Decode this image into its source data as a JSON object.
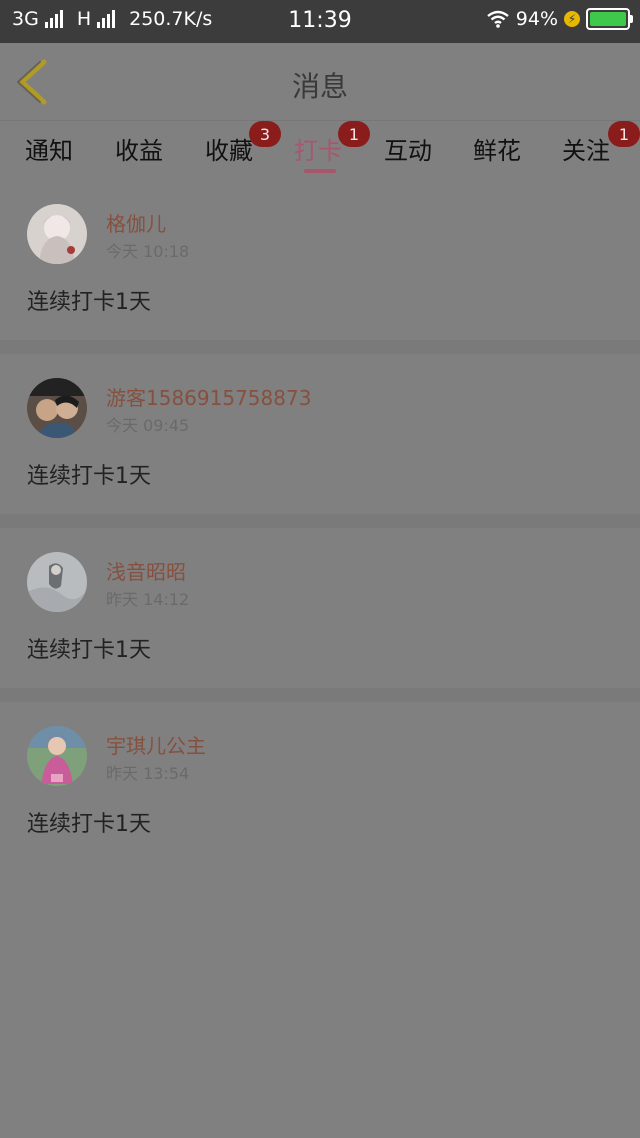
{
  "status_bar": {
    "network": "3G",
    "network2": "H",
    "speed": "250.7K/s",
    "time": "11:39",
    "battery": "94%",
    "battery_color": "#3fc94a"
  },
  "header": {
    "title": "消息",
    "back_icon": "chevron-left-icon",
    "back_color": "#b09a2a"
  },
  "tabs": [
    {
      "label": "通知",
      "badge": ""
    },
    {
      "label": "收益",
      "badge": ""
    },
    {
      "label": "收藏",
      "badge": "3"
    },
    {
      "label": "打卡",
      "badge": "1",
      "active": true
    },
    {
      "label": "互动",
      "badge": ""
    },
    {
      "label": "鲜花",
      "badge": ""
    },
    {
      "label": "关注",
      "badge": "1"
    }
  ],
  "colors": {
    "accent": "#a8566e",
    "badge": "#8a1c1c",
    "username": "#86503f"
  },
  "messages": [
    {
      "name": "格伽儿",
      "time": "今天 10:18",
      "text": "连续打卡1天"
    },
    {
      "name": "游客1586915758873",
      "time": "今天 09:45",
      "text": "连续打卡1天"
    },
    {
      "name": "浅音昭昭",
      "time": "昨天 14:12",
      "text": "连续打卡1天"
    },
    {
      "name": "宇琪儿公主",
      "time": "昨天 13:54",
      "text": "连续打卡1天"
    }
  ]
}
